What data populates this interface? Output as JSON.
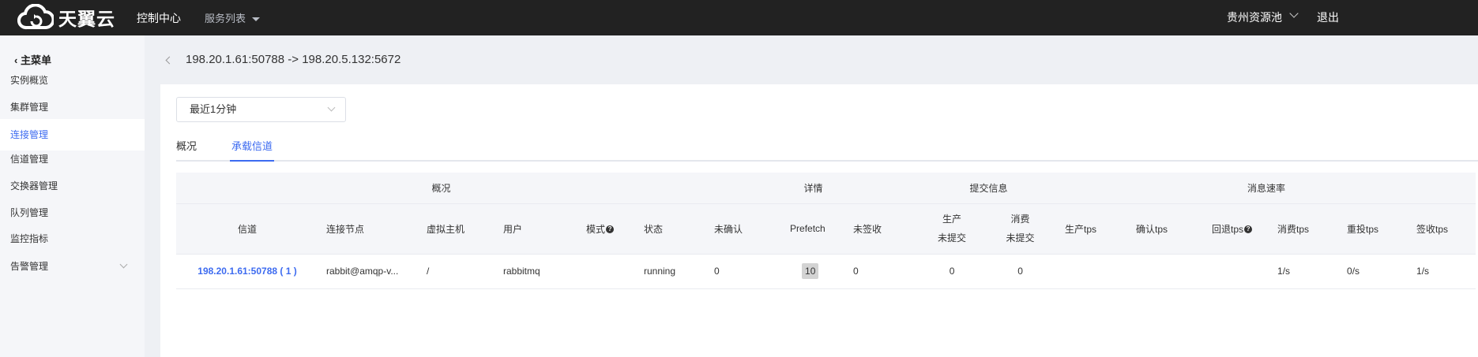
{
  "header": {
    "brand": "天翼云",
    "console": "控制中心",
    "services": "服务列表",
    "region": "贵州资源池",
    "logout": "退出"
  },
  "sidebar": {
    "back": "主菜单",
    "items": [
      {
        "label": "实例概览"
      },
      {
        "label": "集群管理"
      },
      {
        "label": "连接管理",
        "active": true
      },
      {
        "label": "信道管理"
      },
      {
        "label": "交换器管理"
      },
      {
        "label": "队列管理"
      },
      {
        "label": "监控指标"
      },
      {
        "label": "告警管理"
      }
    ]
  },
  "breadcrumb": "198.20.1.61:50788 -> 198.20.5.132:5672",
  "time_select": "最近1分钟",
  "tabs": [
    {
      "label": "概况"
    },
    {
      "label": "承载信道",
      "active": true
    }
  ],
  "table": {
    "groups": [
      "概况",
      "详情",
      "提交信息",
      "消息速率"
    ],
    "columns": [
      "信道",
      "连接节点",
      "虚拟主机",
      "用户",
      "模式",
      "状态",
      "未确认",
      "Prefetch",
      "未签收",
      "生产",
      "未提交",
      "消费",
      "未提交",
      "生产tps",
      "确认tps",
      "回退tps",
      "消费tps",
      "重投tps",
      "签收tps"
    ],
    "help_mark": "?",
    "rows": [
      {
        "channel": "198.20.1.61:50788 ( 1 )",
        "node": "rabbit@amqp-v...",
        "vhost": "/",
        "user": "rabbitmq",
        "mode": "",
        "state": "running",
        "unacked": "0",
        "prefetch": "10",
        "unconfirmed": "0",
        "pub_uncommitted": "0",
        "con_uncommitted": "0",
        "pub_tps": "",
        "ack_tps": "",
        "nack_tps": "",
        "con_tps": "1/s",
        "redeliver_tps": "0/s",
        "sign_tps": "1/s"
      }
    ]
  },
  "colors": {
    "accent": "#3d6bf0",
    "topbar": "#222222"
  }
}
